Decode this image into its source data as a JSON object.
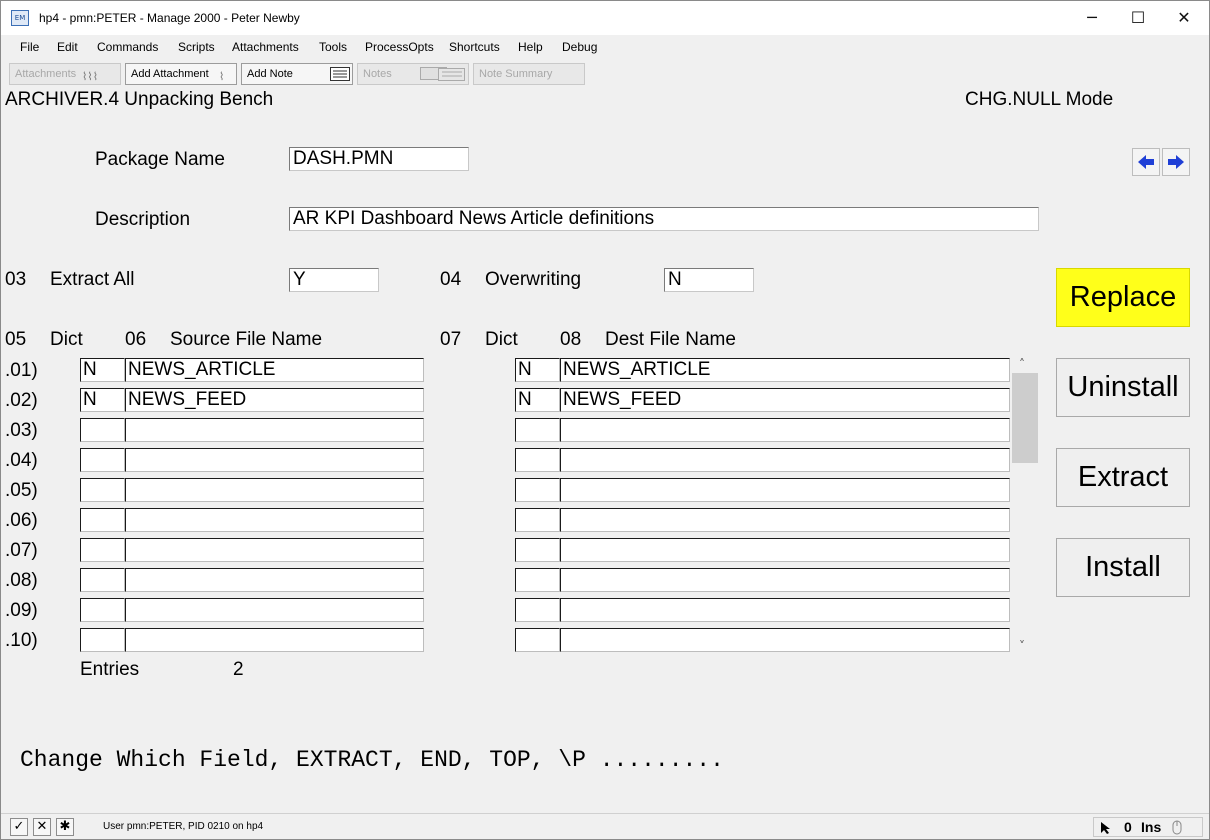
{
  "window": {
    "title": "hp4 - pmn:PETER - Manage 2000 - Peter Newby",
    "icon_text": "EM",
    "minimize": "─",
    "maximize": "☐",
    "close": "✕"
  },
  "menu": [
    "File",
    "Edit",
    "Commands",
    "Scripts",
    "Attachments",
    "Tools",
    "ProcessOpts",
    "Shortcuts",
    "Help",
    "Debug"
  ],
  "toolbar": {
    "attachments": "Attachments",
    "add_attachment": "Add Attachment",
    "add_note": "Add Note",
    "notes": "Notes",
    "note_summary": "Note Summary"
  },
  "header": {
    "screen_title": "ARCHIVER.4 Unpacking Bench",
    "mode": "CHG.NULL Mode"
  },
  "form": {
    "package_name_label": "Package Name",
    "package_name_value": "DASH.PMN",
    "description_label": "Description",
    "description_value": "AR KPI Dashboard News Article definitions",
    "extract_all_num": "03",
    "extract_all_label": "Extract All",
    "extract_all_value": "Y",
    "overwriting_num": "04",
    "overwriting_label": "Overwriting",
    "overwriting_value": "N"
  },
  "grid": {
    "col05_num": "05",
    "col05_label": "Dict",
    "col06_num": "06",
    "col06_label": "Source File Name",
    "col07_num": "07",
    "col07_label": "Dict",
    "col08_num": "08",
    "col08_label": "Dest File Name",
    "rows": [
      {
        "num": ".01)",
        "src_dict": "N",
        "src_file": "NEWS_ARTICLE",
        "dst_dict": "N",
        "dst_file": "NEWS_ARTICLE"
      },
      {
        "num": ".02)",
        "src_dict": "N",
        "src_file": "NEWS_FEED",
        "dst_dict": "N",
        "dst_file": "NEWS_FEED"
      },
      {
        "num": ".03)",
        "src_dict": "",
        "src_file": "",
        "dst_dict": "",
        "dst_file": ""
      },
      {
        "num": ".04)",
        "src_dict": "",
        "src_file": "",
        "dst_dict": "",
        "dst_file": ""
      },
      {
        "num": ".05)",
        "src_dict": "",
        "src_file": "",
        "dst_dict": "",
        "dst_file": ""
      },
      {
        "num": ".06)",
        "src_dict": "",
        "src_file": "",
        "dst_dict": "",
        "dst_file": ""
      },
      {
        "num": ".07)",
        "src_dict": "",
        "src_file": "",
        "dst_dict": "",
        "dst_file": ""
      },
      {
        "num": ".08)",
        "src_dict": "",
        "src_file": "",
        "dst_dict": "",
        "dst_file": ""
      },
      {
        "num": ".09)",
        "src_dict": "",
        "src_file": "",
        "dst_dict": "",
        "dst_file": ""
      },
      {
        "num": ".10)",
        "src_dict": "",
        "src_file": "",
        "dst_dict": "",
        "dst_file": ""
      }
    ],
    "entries_label": "Entries",
    "entries_value": "2"
  },
  "actions": {
    "replace": "Replace",
    "uninstall": "Uninstall",
    "extract": "Extract",
    "install": "Install"
  },
  "command_prompt": "Change Which Field, EXTRACT, END, TOP, \\P .........",
  "statusbar": {
    "check": "✓",
    "cross": "✕",
    "star": "✱",
    "text": "User pmn:PETER, PID 0210 on hp4",
    "counter": "0",
    "ins": "Ins"
  },
  "colors": {
    "highlight": "#ffff1a",
    "nav_arrow": "#1f3fd6"
  }
}
